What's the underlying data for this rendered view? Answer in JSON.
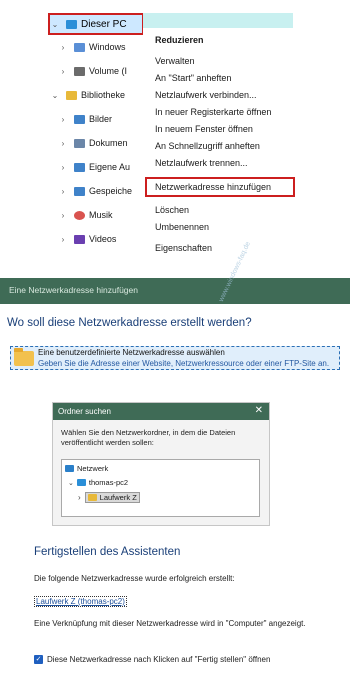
{
  "explorer": {
    "this_pc": "Dieser PC",
    "items": [
      {
        "label": "Windows",
        "icon": "drive-icon",
        "color": "#5a8fd6"
      },
      {
        "label": "Volume (I",
        "icon": "drive-icon",
        "color": "#6b6b6b"
      },
      {
        "label": "Bibliotheke",
        "icon": "library-folder-icon",
        "color": "#e8b93a"
      },
      {
        "label": "Bilder",
        "icon": "pictures-icon",
        "color": "#3f82c9"
      },
      {
        "label": "Dokumen",
        "icon": "documents-icon",
        "color": "#6b86a8"
      },
      {
        "label": "Eigene Au",
        "icon": "recordings-icon",
        "color": "#3f82c9"
      },
      {
        "label": "Gespeiche",
        "icon": "saved-pictures-icon",
        "color": "#3f82c9"
      },
      {
        "label": "Musik",
        "icon": "music-icon",
        "color": "#d9534f"
      },
      {
        "label": "Videos",
        "icon": "videos-icon",
        "color": "#6a3fb0"
      }
    ]
  },
  "context_menu": {
    "items": [
      "Reduzieren",
      "Verwalten",
      "An \"Start\" anheften",
      "Netzlaufwerk verbinden...",
      "In neuer Registerkarte öffnen",
      "In neuem Fenster öffnen",
      "An Schnellzugriff anheften",
      "Netzlaufwerk trennen...",
      "Netzwerkadresse hinzufügen",
      "Löschen",
      "Umbenennen",
      "Eigenschaften"
    ]
  },
  "wizard": {
    "title": "Eine Netzwerkadresse hinzufügen",
    "question": "Wo soll diese Netzwerkadresse erstellt werden?",
    "option_title": "Eine benutzerdefinierte Netzwerkadresse auswählen",
    "option_desc": "Geben Sie die Adresse einer Website, Netzwerkressource oder einer FTP-Site an."
  },
  "folder_dialog": {
    "title": "Ordner suchen",
    "close": "✕",
    "description": "Wählen Sie den Netzwerkordner, in dem die Dateien veröffentlicht werden sollen:",
    "tree": [
      "Netzwerk",
      "thomas-pc2",
      "Laufwerk Z"
    ]
  },
  "finish": {
    "heading": "Fertigstellen des Assistenten",
    "success_text": "Die folgende Netzwerkadresse wurde erfolgreich erstellt:",
    "link": "Laufwerk Z (thomas-pc2)",
    "info_text": "Eine Verknüpfung mit dieser Netzwerkadresse wird in \"Computer\" angezeigt.",
    "checkbox_label": "Diese Netzwerkadresse nach Klicken auf \"Fertig stellen\" öffnen",
    "checkbox_checked": true
  },
  "watermark": "www.windows-faq.de"
}
